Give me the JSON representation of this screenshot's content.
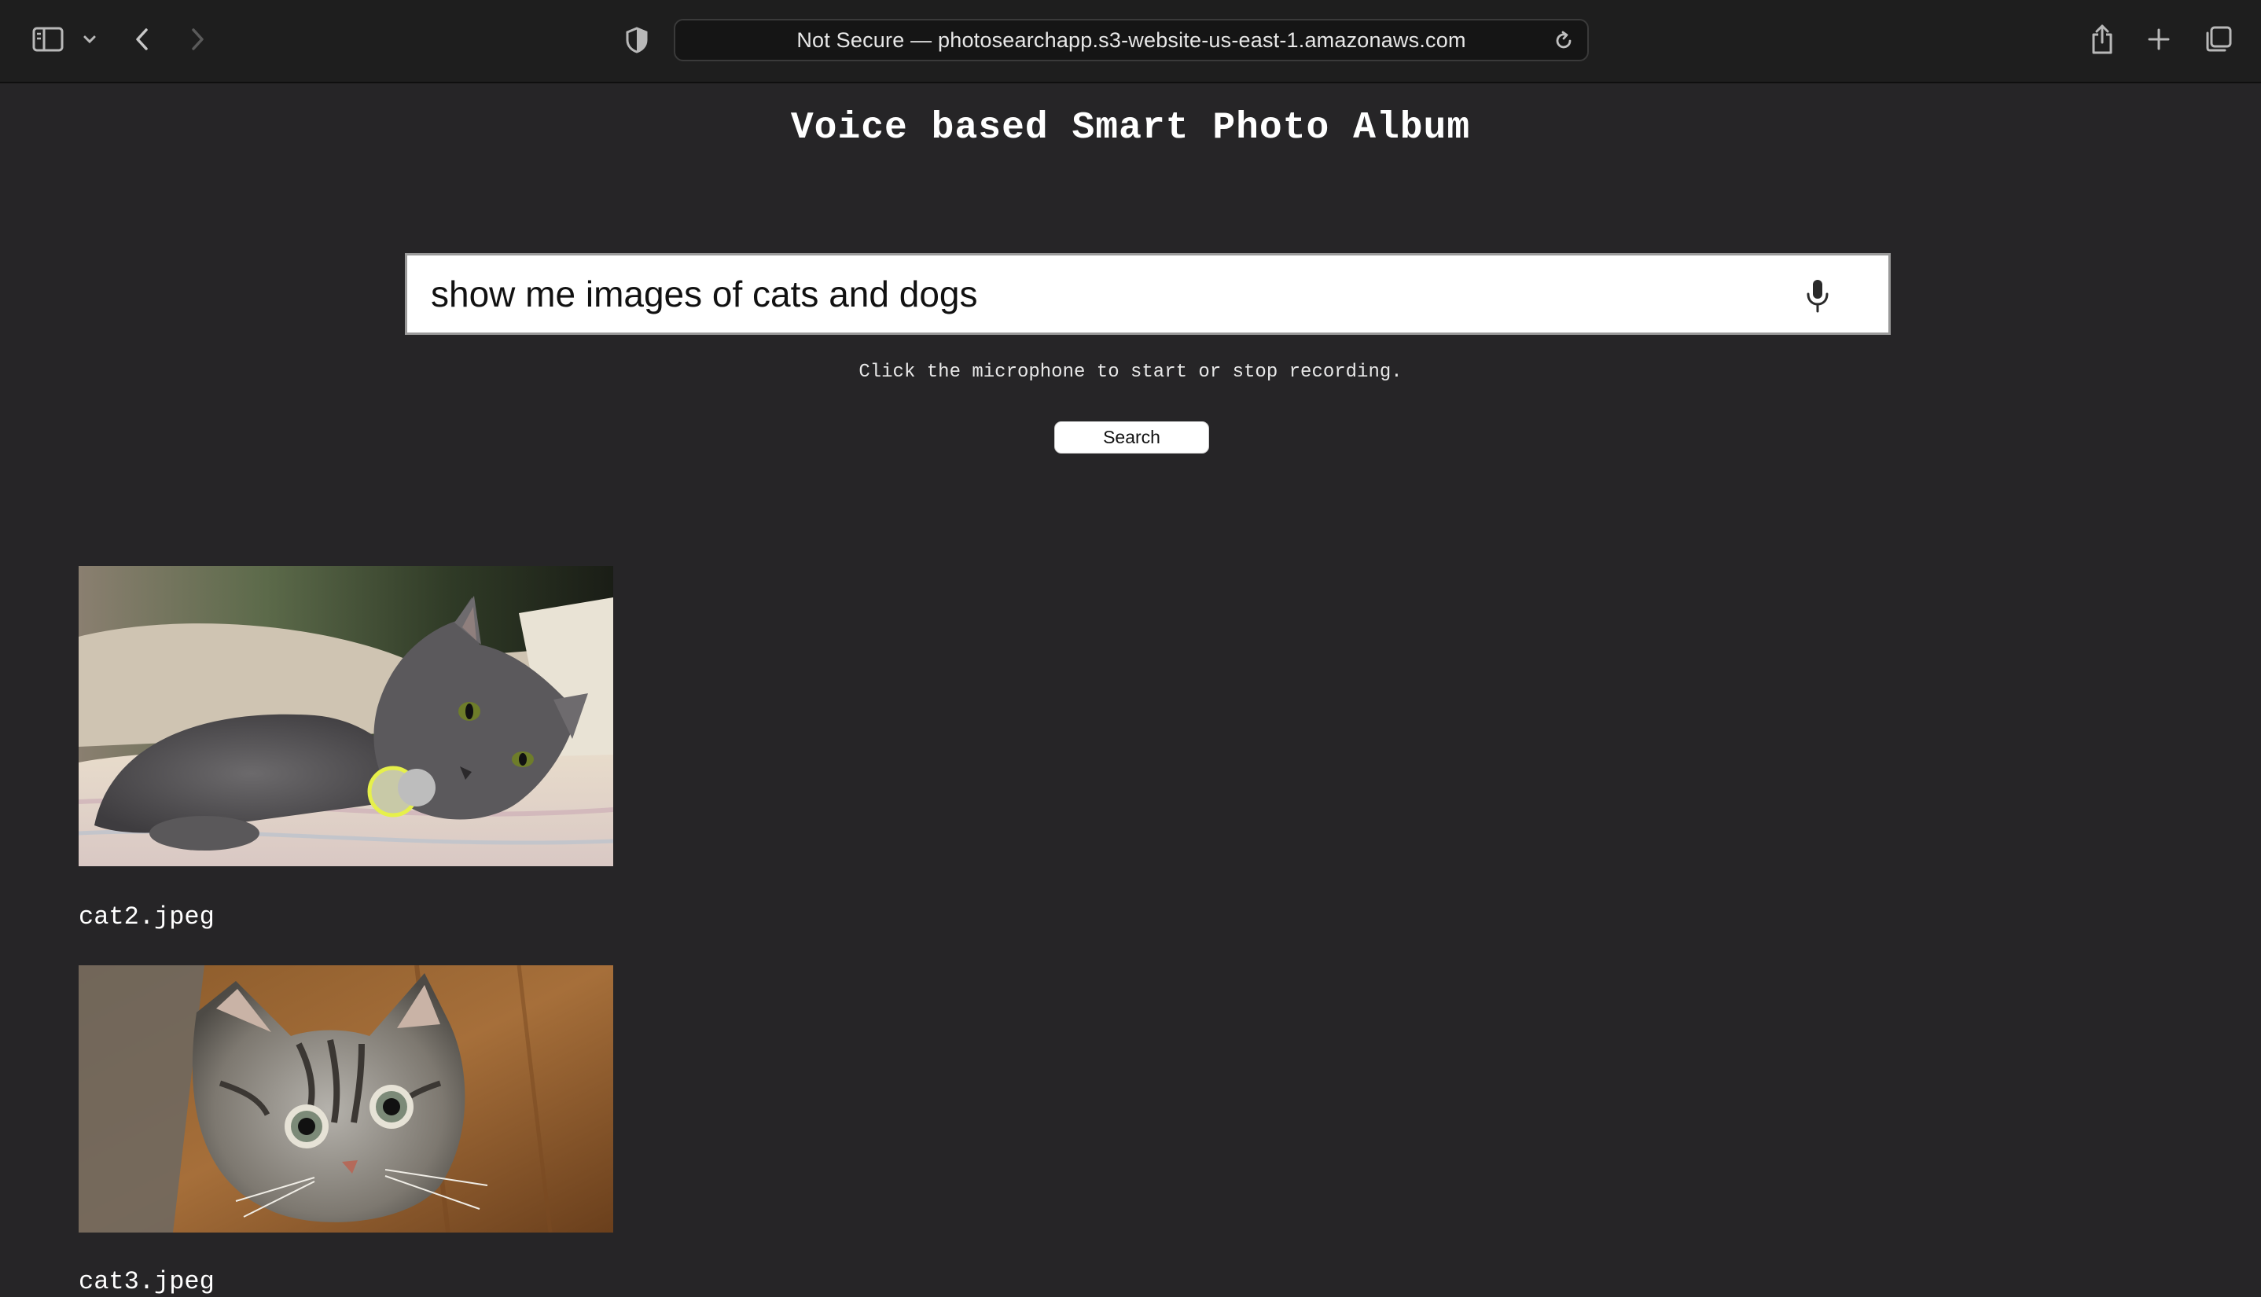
{
  "browser": {
    "address_bar": "Not Secure — photosearchapp.s3-website-us-east-1.amazonaws.com",
    "icons": [
      "sidebar-icon",
      "chevron-down-icon",
      "back-icon",
      "forward-icon",
      "privacy-shield-icon",
      "reload-icon",
      "share-icon",
      "new-tab-icon",
      "tab-overview-icon"
    ]
  },
  "page": {
    "title": "Voice based Smart Photo Album",
    "search": {
      "value": "show me images of cats and dogs",
      "mic_icon": "microphone-icon"
    },
    "hint": "Click the microphone to start or stop recording.",
    "search_button_label": "Search"
  },
  "results": [
    {
      "filename": "cat2.jpeg"
    },
    {
      "filename": "cat3.jpeg"
    }
  ]
}
